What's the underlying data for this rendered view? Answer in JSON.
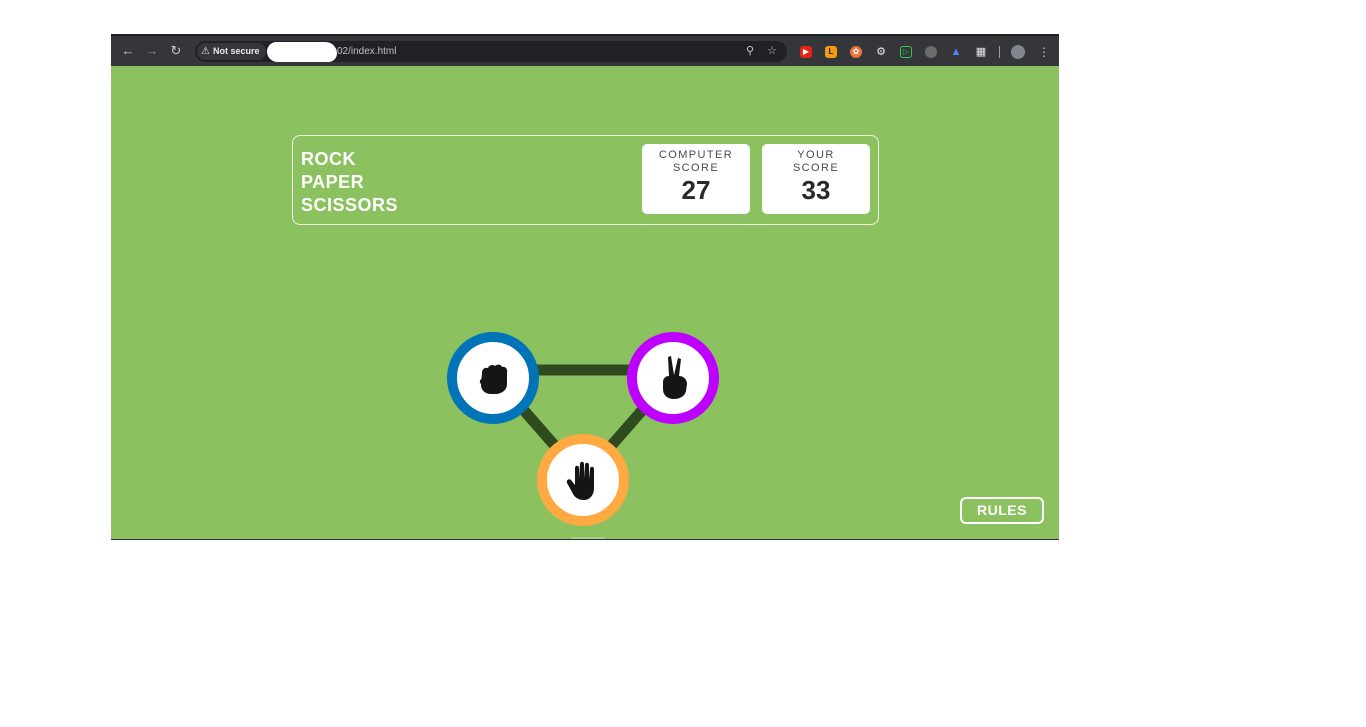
{
  "browser": {
    "security_label": "Not secure",
    "url_visible": "02/index.html",
    "icons": [
      "back-arrow-icon",
      "forward-arrow-icon",
      "reload-icon",
      "warning-icon",
      "zoom-icon",
      "bookmark-star-icon",
      "extension-youtube-icon",
      "extension-lb-icon",
      "extension-orange-icon",
      "extension-react-icon",
      "extension-green-icon",
      "extension-gray-icon",
      "extension-flame-icon",
      "extensions-puzzle-icon",
      "profile-avatar-icon",
      "menu-kebab-icon"
    ]
  },
  "game": {
    "title_lines": [
      "ROCK",
      "PAPER",
      "SCISSORS"
    ],
    "computer_score": {
      "label_line1": "COMPUTER",
      "label_line2": "SCORE",
      "value": "27"
    },
    "your_score": {
      "label_line1": "YOUR",
      "label_line2": "SCORE",
      "value": "33"
    },
    "choices": [
      {
        "name": "rock",
        "ring_color": "#0074b6",
        "icon": "fist-icon"
      },
      {
        "name": "scissors",
        "ring_color": "#bd00ff",
        "icon": "victory-hand-icon"
      },
      {
        "name": "paper",
        "ring_color": "#ffa943",
        "icon": "open-hand-icon"
      }
    ],
    "connector_color": "#2f4a1f",
    "background_color": "#8bc25f",
    "rules_label": "RULES"
  }
}
